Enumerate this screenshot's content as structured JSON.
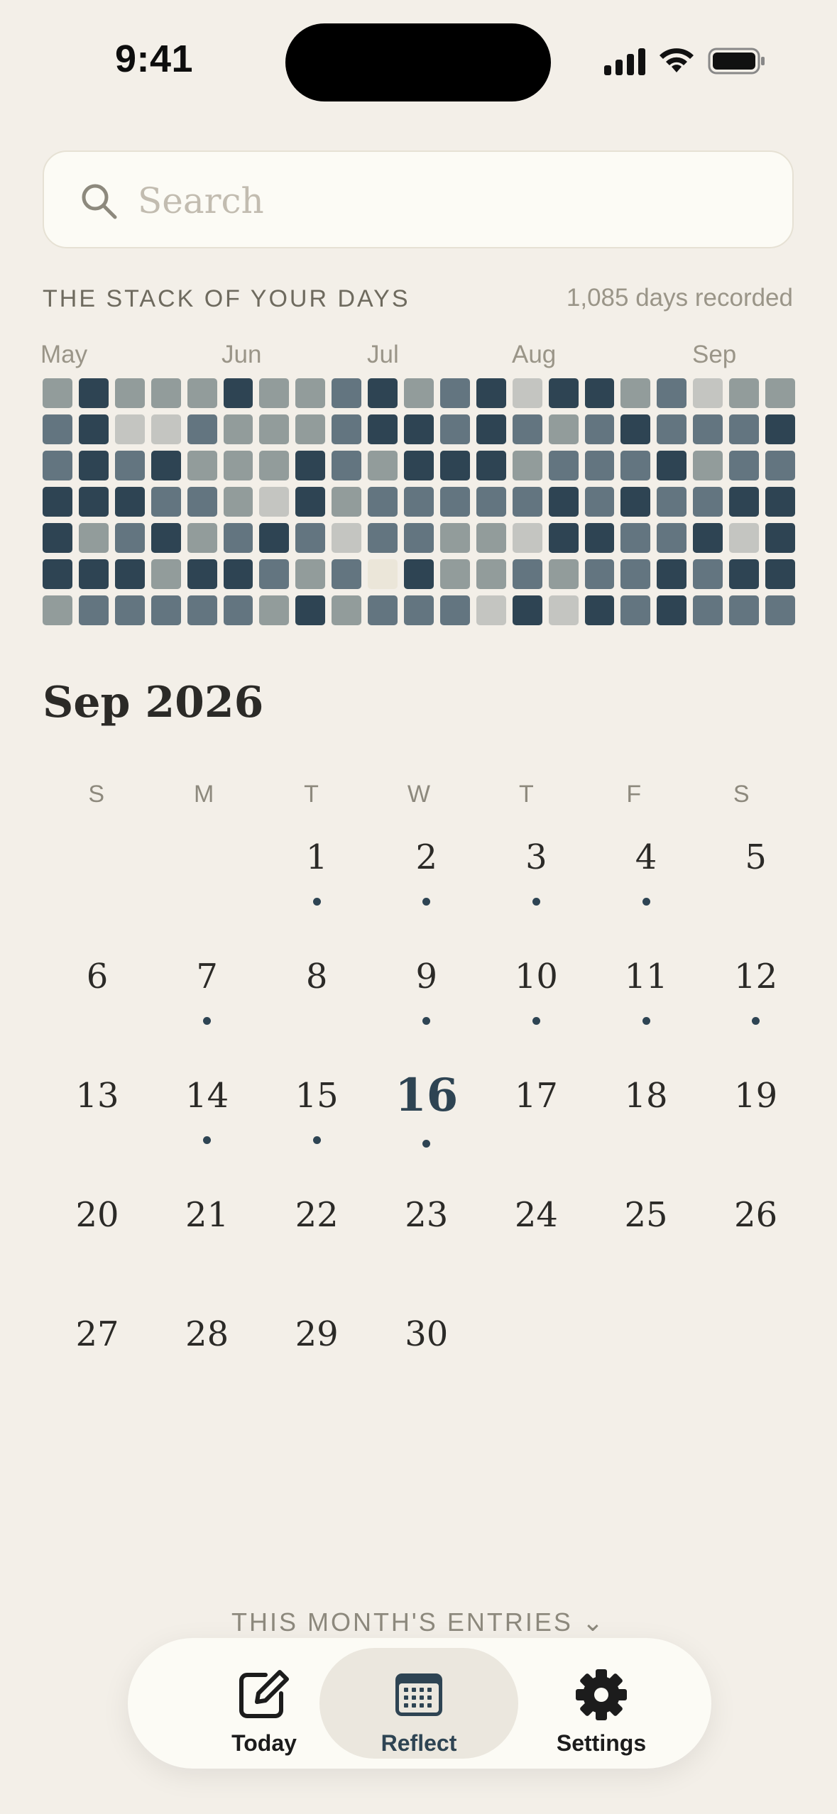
{
  "status_bar": {
    "time": "9:41"
  },
  "search": {
    "placeholder": "Search"
  },
  "stack": {
    "title": "THE STACK OF YOUR DAYS",
    "count_label": "1,085 days recorded",
    "months": [
      "May",
      "Jun",
      "Jul",
      "Aug",
      "Sep"
    ],
    "levels": [
      [
        2,
        4,
        2,
        2,
        2,
        4,
        2,
        2,
        3,
        4,
        2,
        3,
        4,
        1,
        4,
        4,
        2,
        3,
        1,
        2,
        2
      ],
      [
        3,
        4,
        1,
        1,
        3,
        2,
        2,
        2,
        3,
        4,
        4,
        3,
        4,
        3,
        2,
        3,
        4,
        3,
        3,
        3,
        4
      ],
      [
        3,
        4,
        3,
        4,
        2,
        2,
        2,
        4,
        3,
        2,
        4,
        4,
        4,
        2,
        3,
        3,
        3,
        4,
        2,
        3,
        3
      ],
      [
        4,
        4,
        4,
        3,
        3,
        2,
        1,
        4,
        2,
        3,
        3,
        3,
        3,
        3,
        4,
        3,
        4,
        3,
        3,
        4,
        4
      ],
      [
        4,
        2,
        3,
        4,
        2,
        3,
        4,
        3,
        1,
        3,
        3,
        2,
        2,
        1,
        4,
        4,
        3,
        3,
        4,
        1,
        4
      ],
      [
        4,
        4,
        4,
        2,
        4,
        4,
        3,
        2,
        3,
        0,
        4,
        2,
        2,
        3,
        2,
        3,
        3,
        4,
        3,
        4,
        4
      ],
      [
        2,
        3,
        3,
        3,
        3,
        3,
        2,
        4,
        2,
        3,
        3,
        3,
        1,
        4,
        1,
        4,
        3,
        4,
        3,
        3,
        3
      ]
    ]
  },
  "calendar": {
    "title": "Sep 2026",
    "weekdays": [
      "S",
      "M",
      "T",
      "W",
      "T",
      "F",
      "S"
    ],
    "first_weekday": 2,
    "days_in_month": 30,
    "today": 16,
    "days_with_entries": [
      1,
      2,
      3,
      4,
      7,
      9,
      10,
      11,
      12,
      14,
      15,
      16
    ]
  },
  "entries_peek": {
    "label": "THIS MONTH'S ENTRIES",
    "chevron": "⌄"
  },
  "tabbar": {
    "tabs": [
      {
        "label": "Today",
        "icon": "compose-icon"
      },
      {
        "label": "Reflect",
        "icon": "calendar-icon"
      },
      {
        "label": "Settings",
        "icon": "gear-icon"
      }
    ],
    "active": "Reflect"
  }
}
